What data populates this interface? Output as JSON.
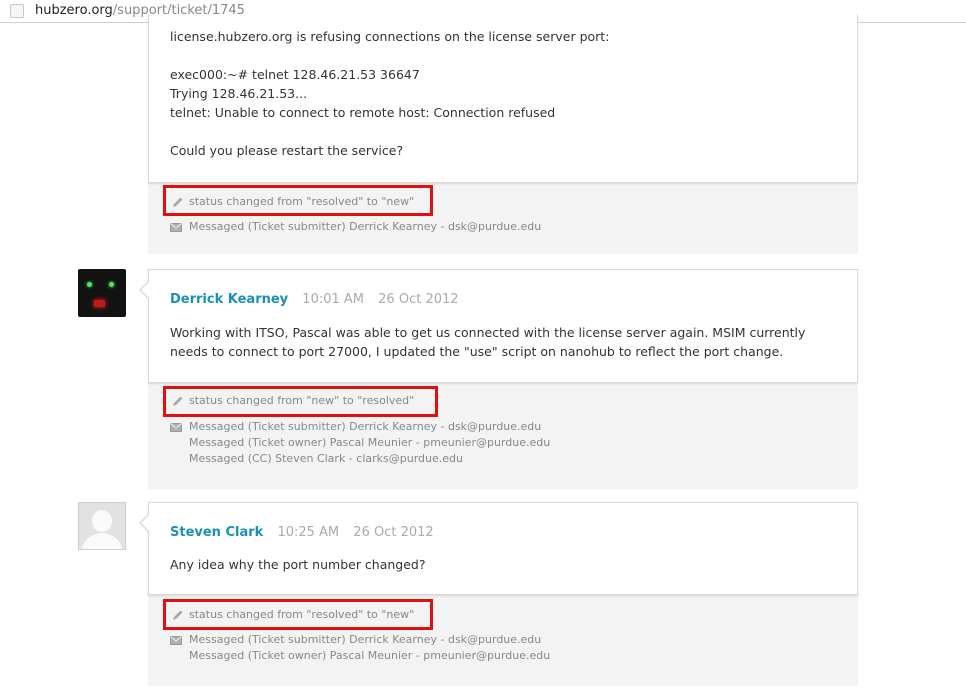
{
  "address_bar": {
    "host": "hubzero.org",
    "path": "/support/ticket/1745"
  },
  "entries": [
    {
      "comment_text": "license.hubzero.org is refusing connections on the license server port:\n\nexec000:~# telnet 128.46.21.53 36647\nTrying 128.46.21.53...\ntelnet: Unable to connect to remote host: Connection refused\n\nCould you please restart the service?",
      "status_change": "status changed from \"resolved\" to \"new\"",
      "messages": [
        "Messaged (Ticket submitter) Derrick Kearney - dsk@purdue.edu"
      ]
    },
    {
      "author": "Derrick Kearney",
      "time": "10:01 AM",
      "date": "26 Oct 2012",
      "avatar": "dark-creature-avatar",
      "comment_text": "Working with ITSO, Pascal was able to get us connected with the license server again. MSIM currently\nneeds to connect to port 27000, I updated the \"use\" script on nanohub to reflect the port change.",
      "status_change": "status changed from \"new\" to \"resolved\"",
      "messages": [
        "Messaged (Ticket submitter) Derrick Kearney - dsk@purdue.edu",
        "Messaged (Ticket owner) Pascal Meunier - pmeunier@purdue.edu",
        "Messaged (CC) Steven Clark - clarks@purdue.edu"
      ]
    },
    {
      "author": "Steven Clark",
      "time": "10:25 AM",
      "date": "26 Oct 2012",
      "avatar": "default-user-avatar",
      "comment_text": "Any idea why the port number changed?",
      "status_change": "status changed from \"resolved\" to \"new\"",
      "messages": [
        "Messaged (Ticket submitter) Derrick Kearney - dsk@purdue.edu",
        "Messaged (Ticket owner) Pascal Meunier - pmeunier@purdue.edu"
      ]
    }
  ],
  "colors": {
    "author_link": "#1b8fb4",
    "highlight_border": "#e01010",
    "footer_bg": "#f3f3f3"
  },
  "icons": {
    "status": "pencil-icon",
    "message": "envelope-icon",
    "page": "page-icon"
  }
}
